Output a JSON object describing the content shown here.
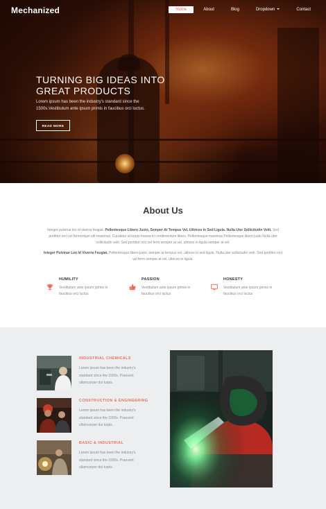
{
  "header": {
    "brand": "Mechanized",
    "nav": [
      {
        "label": "Home",
        "active": true
      },
      {
        "label": "About"
      },
      {
        "label": "Blog"
      },
      {
        "label": "Dropdown"
      },
      {
        "label": "Contact"
      }
    ]
  },
  "hero": {
    "title_line1": "TURNING BIG IDEAS INTO",
    "title_line2": "GREAT PRODUCTS",
    "text": "Lorem ipsum has been the industry's standard since the 1500s.Vestibulum ante ipsum primis in faucibus orci luctus.",
    "button": "READ MORE"
  },
  "about": {
    "title": "About Us",
    "p1_plain_a": "Integer pulvinar leo id viverra feugiat. ",
    "p1_bold": "Pellentesque Libero Justo, Semper At Tempus Vel, Ultrices In Sed Ligula. Nulla Uter Sollicitudin Velit.",
    "p1_plain_b": " Sed porttitor orci vel fermentum elit maximus. Curabitur ut turpis massa in condimentum libero. Pellentesque maximus Pellentesque libero justo Nulla uter sollicitudin velit. Sed porttitor orci vel ferm semper at vel, ultrices in ligula semper at vel.",
    "p2_bold": "Integer Pulvinar Leo Id Viverra Feugiat.",
    "p2_plain": " Pellentesque libero justo, semper at tempus vel, ultrices in sed ligula. Nulla uter sollicitudin velit. Sed porttitor orci vel ferm semper at vel, ultrices in ligula.",
    "features": [
      {
        "title": "HUMILITY",
        "text": "Vestibulum ante ipsum primis in faucibus orci luctus",
        "icon": "trophy-icon"
      },
      {
        "title": "PASSION",
        "text": "Vestibulum ante ipsum primis in faucibus orci luctus",
        "icon": "thumbs-up-icon"
      },
      {
        "title": "HONESTY",
        "text": "Vestibulum ante ipsum primis in faucibus orci luctus",
        "icon": "monitor-icon"
      }
    ]
  },
  "services": [
    {
      "title": "INDUSTRIAL CHEMICALS",
      "text": "Lorem ipsum has been the industry's standard since the 1500s. Praesent ullamcorper dui turpis."
    },
    {
      "title": "CONSTRUCTION & ENGINEERING",
      "text": "Lorem ipsum has been the industry's standard since the 1500s. Praesent ullamcorper dui turpis."
    },
    {
      "title": "BASIC & INDUSTRIAL",
      "text": "Lorem ipsum has been the industry's standard since the 1500s. Praesent ullamcorper dui turpis."
    }
  ],
  "colors": {
    "accent": "#e96e5a",
    "services_bg": "#edeef0",
    "hero_dark": "#3a1408"
  }
}
